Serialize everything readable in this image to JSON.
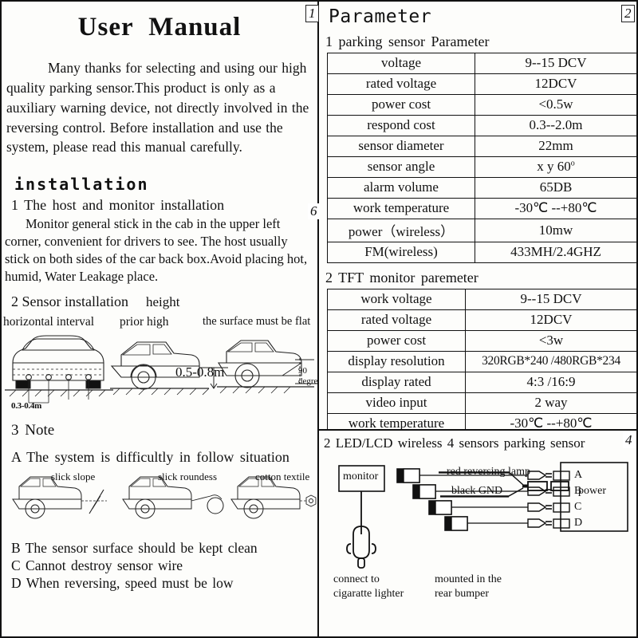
{
  "document": {
    "title": "User  Manual",
    "intro": "Many  thanks for selecting and  using our high quality parking sensor.This product is only as a auxiliary warning device, not directly involved in the reversing control.   Before installation and use the system, please read this manual carefully."
  },
  "page_marks": {
    "left_top": "1",
    "left_mid": "6",
    "right_top": "2",
    "right_mid": "4"
  },
  "installation": {
    "heading": "installation",
    "item1_title": "1  The  host and monitor  installation",
    "item1_body": "Monitor general stick in the cab in the upper left corner, convenient for drivers to see. The host usually stick on both sides of  the car back box.Avoid placing hot, humid, Water Leakage place.",
    "item2_title": "2  Sensor installation",
    "item2_extra": "height",
    "diagram_captions": {
      "horizontal": "horizontal interval",
      "prior": "prior high",
      "flat": "the surface must be flat"
    },
    "dimensions": {
      "interval": "0.3-0.4m",
      "height": "0.5-0.8m",
      "angle_value": "90",
      "angle_unit": "degree"
    }
  },
  "note": {
    "heading": "3  Note",
    "a": "A  The  system  is  difficultly  in follow  situation",
    "captions": {
      "slope": "slick slope",
      "roundness": "slick  roundess",
      "cotton": "cotton textile"
    },
    "b": "B  The sensor  surface should be kept clean",
    "c": "C  Cannot destroy sensor wire",
    "d": "D  When reversing, speed must be low"
  },
  "parameter": {
    "title": "Parameter",
    "table1": {
      "heading": "1  parking sensor Parameter",
      "rows": [
        {
          "key": "voltage",
          "value": "9--15 DCV"
        },
        {
          "key": "rated voltage",
          "value": "12DCV"
        },
        {
          "key": "power cost",
          "value": "<0.5w"
        },
        {
          "key": "respond cost",
          "value": "0.3--2.0m"
        },
        {
          "key": "sensor diameter",
          "value": "22mm"
        },
        {
          "key": "sensor  angle",
          "value": "x  y  60"
        },
        {
          "key": "alarm volume",
          "value": "65DB"
        },
        {
          "key": "work temperature",
          "value": "-30℃ --+80℃"
        },
        {
          "key": "power（wireless）",
          "value": "10mw"
        },
        {
          "key": "FM(wireless)",
          "value": "433MH/2.4GHZ"
        }
      ]
    },
    "table2": {
      "heading": "2  TFT  monitor  paremeter",
      "rows": [
        {
          "key": "work   voltage",
          "value": "9--15 DCV"
        },
        {
          "key": "rated   voltage",
          "value": "12DCV"
        },
        {
          "key": "power   cost",
          "value": "<3w"
        },
        {
          "key": "display resolution",
          "value": "320RGB*240 /480RGB*234"
        },
        {
          "key": "display rated",
          "value": "4:3  /16:9"
        },
        {
          "key": "video  input",
          "value": "2  way"
        },
        {
          "key": "work  temperature",
          "value": "-30℃ --+80℃"
        }
      ]
    }
  },
  "wiring": {
    "heading": "2 LED/LCD  wireless  4  sensors  parking  sensor",
    "monitor_label": "monitor",
    "red_label": "red  reversing  lamp",
    "black_label": "black   GND",
    "power_label": "power",
    "connect_label": "connect  to",
    "connect_label2": "cigaratte lighter",
    "mounted_label": "mounted  in  the",
    "mounted_label2": "rear  bumper",
    "terminals": [
      "A",
      "B",
      "C",
      "D"
    ]
  }
}
